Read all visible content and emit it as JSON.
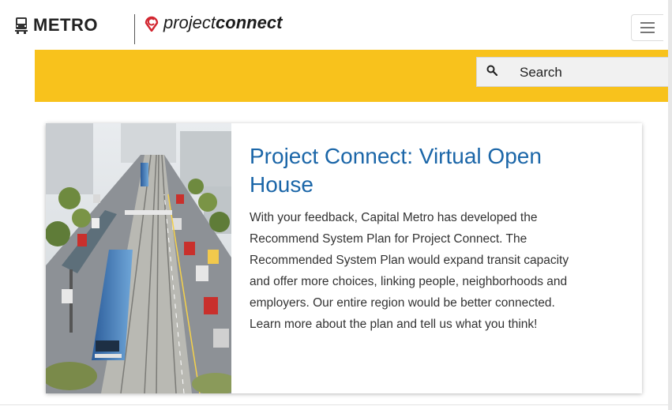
{
  "header": {
    "metro_logo_text": "METRO",
    "project_connect_light": "project",
    "project_connect_bold": "connect",
    "menu_icon": "hamburger-menu-icon"
  },
  "search": {
    "placeholder": "Search",
    "icon": "search-icon"
  },
  "colors": {
    "brand_yellow": "#f8c21c",
    "title_blue": "#1b66a8",
    "brand_red": "#d22630"
  },
  "card": {
    "title_lines": [
      "Project Connect: Virtual Open",
      "House"
    ],
    "body_lines": [
      "With your feedback, Capital Metro has developed the",
      "Recommend System Plan for Project Connect. The",
      "Recommended System Plan would expand transit capacity",
      "and offer more choices, linking people, neighborhoods and",
      "employers. Our entire region would be better connected.",
      "Learn more about the plan and tell us what you think!"
    ]
  }
}
